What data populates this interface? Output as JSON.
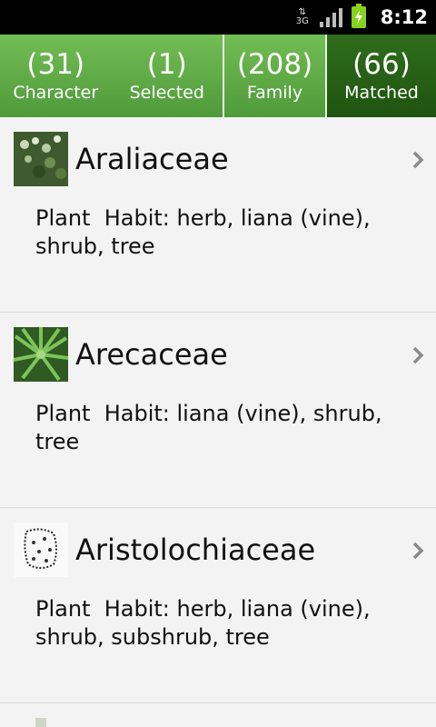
{
  "status_bar": {
    "network_top": "⇅",
    "network_type": "3G",
    "time": "8:12",
    "icons": [
      "data-arrows-icon",
      "signal-icon",
      "battery-charging-icon"
    ]
  },
  "tabs": [
    {
      "count": "(31)",
      "label": "Character"
    },
    {
      "count": "(1)",
      "label": "Selected"
    },
    {
      "count": "(208)",
      "label": "Family"
    },
    {
      "count": "(66)",
      "label": "Matched"
    }
  ],
  "families": [
    {
      "name": "Araliaceae",
      "habit": "Plant  Habit: herb, liana (vine), shrub, tree"
    },
    {
      "name": "Arecaceae",
      "habit": "Plant  Habit: liana (vine), shrub, tree"
    },
    {
      "name": "Aristolochiaceae",
      "habit": "Plant  Habit: herb, liana (vine), shrub, subshrub, tree"
    }
  ],
  "colors": {
    "tab_green": "#5ba342",
    "tab_active": "#245a14",
    "background": "#f3f3f3"
  }
}
